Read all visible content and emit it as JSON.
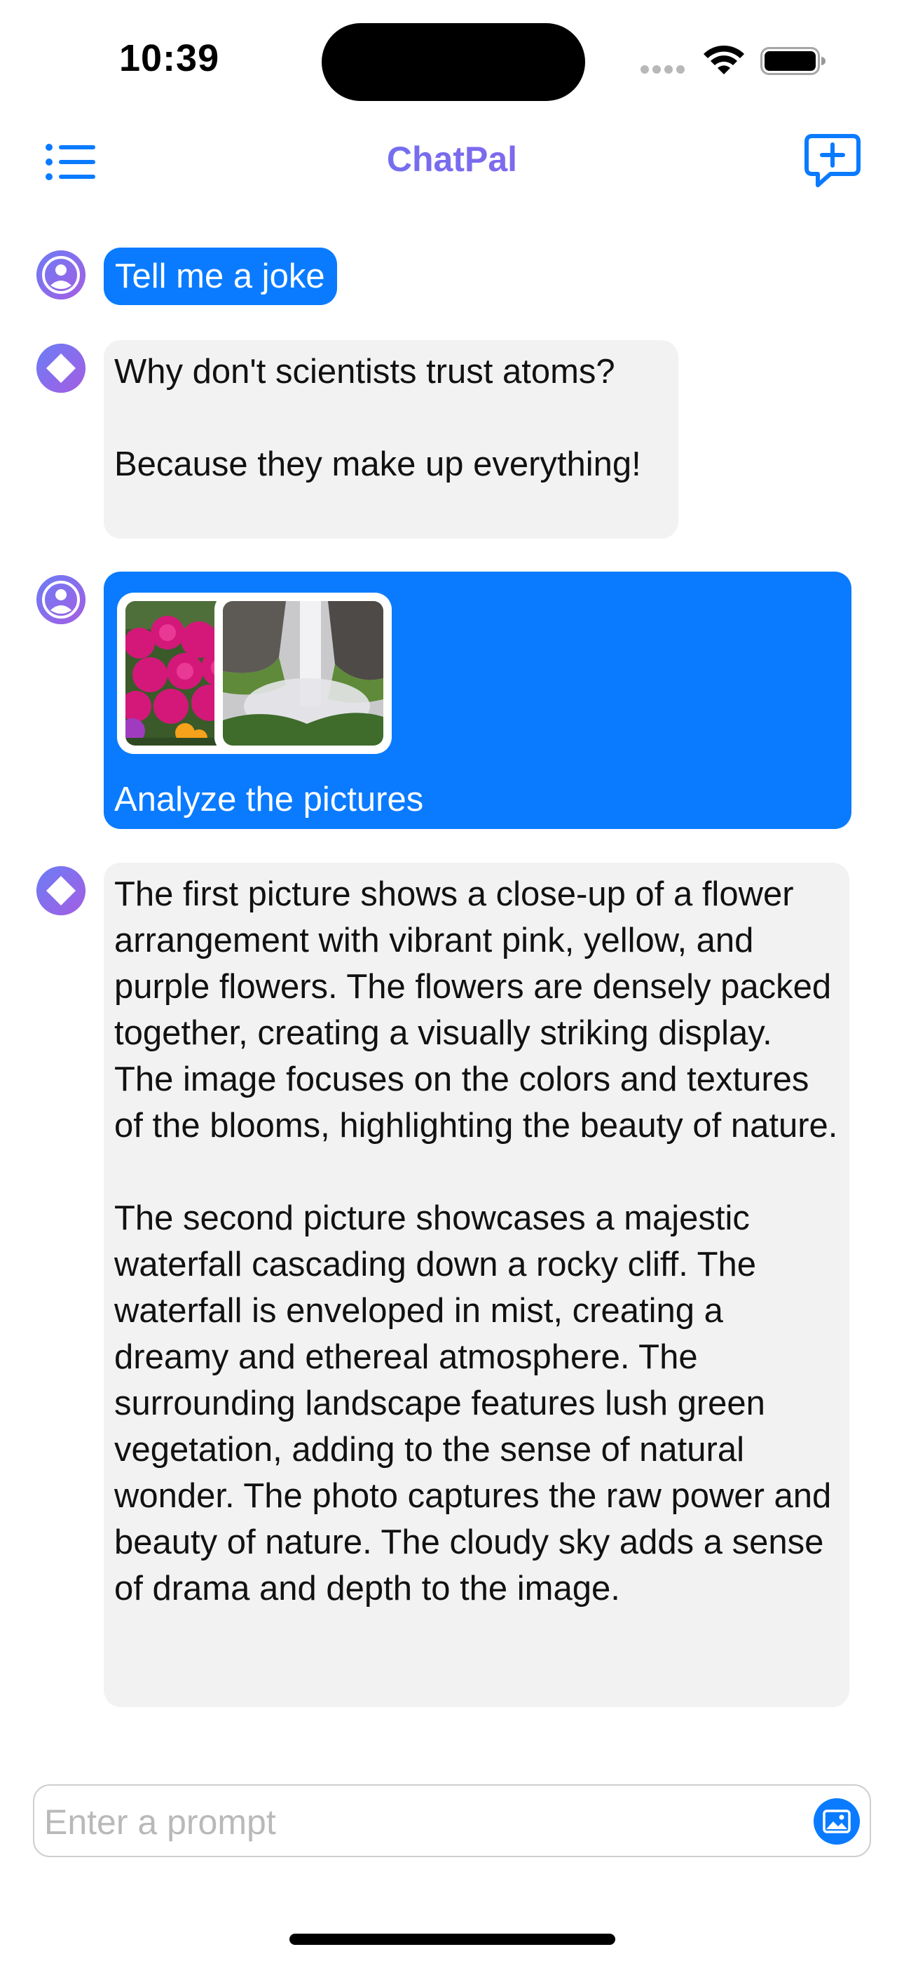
{
  "status_bar": {
    "time": "10:39"
  },
  "nav": {
    "title": "ChatPal"
  },
  "messages": [
    {
      "role": "user",
      "text": "Tell me a joke"
    },
    {
      "role": "assistant",
      "text": "Why don't scientists trust atoms?\n\nBecause they make up everything!"
    },
    {
      "role": "user",
      "text": "Analyze the pictures",
      "attachments": [
        "flowers-photo",
        "waterfall-photo"
      ]
    },
    {
      "role": "assistant",
      "text": "The first picture shows a close-up of a flower arrangement with vibrant pink, yellow, and purple flowers. The flowers are densely packed together, creating a visually striking display. The image focuses on the colors and textures of the blooms, highlighting the beauty of nature.\n\nThe second picture showcases a majestic waterfall cascading down a rocky cliff. The waterfall is enveloped in mist, creating a dreamy and ethereal atmosphere. The surrounding landscape features lush green vegetation, adding to the sense of natural wonder. The photo captures the raw power and beauty of nature.  The cloudy sky adds a sense of drama and depth to the image."
    }
  ],
  "input": {
    "placeholder": "Enter a prompt",
    "value": ""
  },
  "colors": {
    "accent": "#0a7bff",
    "assistant_bubble": "#f2f2f2",
    "avatar_gradient_start": "#6b7df5",
    "avatar_gradient_end": "#a55de3"
  },
  "icons": {
    "menu": "list-icon",
    "new_chat": "message-plus-icon",
    "user_avatar": "person-icon",
    "assistant_avatar": "diamond-icon",
    "attach": "photo-icon"
  }
}
